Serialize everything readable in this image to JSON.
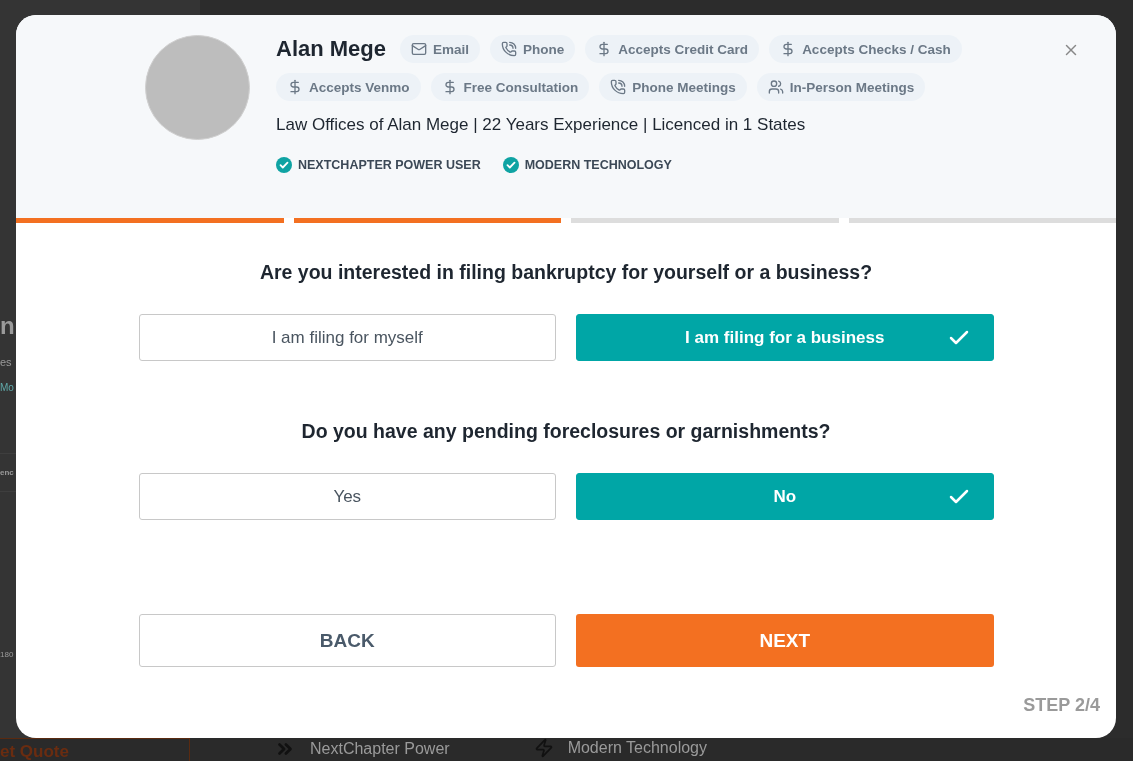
{
  "background": {
    "heading": "n",
    "subtitle": "es",
    "link": "Mo",
    "tab": "enc",
    "phone": "180",
    "quote_button": "et Quote",
    "features": [
      {
        "kind": "chevrons",
        "label": "NextChapter Power"
      },
      {
        "kind": "bolt",
        "label": "Modern Technology"
      }
    ]
  },
  "modal": {
    "profile": {
      "name": "Alan Mege",
      "contacts": [
        {
          "kind": "email",
          "label": "Email"
        },
        {
          "kind": "phone",
          "label": "Phone"
        },
        {
          "kind": "dollar",
          "label": "Accepts Credit Card"
        },
        {
          "kind": "dollar",
          "label": "Accepts Checks / Cash"
        },
        {
          "kind": "dollar",
          "label": "Accepts Venmo"
        },
        {
          "kind": "dollar",
          "label": "Free Consultation"
        },
        {
          "kind": "phone",
          "label": "Phone Meetings"
        },
        {
          "kind": "people",
          "label": "In-Person Meetings"
        }
      ],
      "summary": "Law Offices of Alan Mege | 22 Years Experience | Licenced in 1 States",
      "badges": [
        "NEXTCHAPTER POWER USER",
        "MODERN TECHNOLOGY"
      ]
    },
    "progress": [
      {
        "done": true
      },
      {
        "done": true
      },
      {
        "done": false
      },
      {
        "done": false
      }
    ],
    "questions": [
      {
        "prompt": "Are you interested in filing bankruptcy for yourself or a business?",
        "options": [
          {
            "label": "I am filing for myself",
            "selected": false
          },
          {
            "label": "I am filing for a business",
            "selected": true
          }
        ]
      },
      {
        "prompt": "Do you have any pending foreclosures or garnishments?",
        "options": [
          {
            "label": "Yes",
            "selected": false
          },
          {
            "label": "No",
            "selected": true
          }
        ]
      }
    ],
    "back_button": "BACK",
    "next_button": "NEXT",
    "step": "STEP 2/4"
  }
}
